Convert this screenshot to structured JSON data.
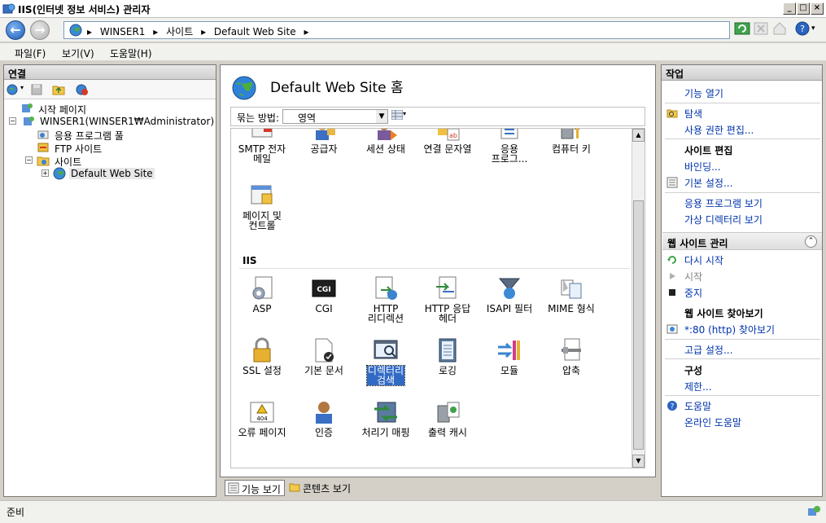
{
  "window": {
    "title": "IIS(인터넷 정보 서비스) 관리자",
    "controls": [
      "_",
      "□",
      "×"
    ]
  },
  "address": {
    "crumbs": [
      "▸",
      "WINSER1",
      "▸",
      "사이트",
      "▸",
      "Default Web Site",
      "▸"
    ]
  },
  "menu": {
    "file": "파일(F)",
    "view": "보기(V)",
    "help": "도움말(H)"
  },
  "connections": {
    "header": "연결",
    "tree": {
      "start_page": "시작 페이지",
      "server": "WINSER1(WINSER1₩Administrator)",
      "app_pools": "응용 프로그램 풀",
      "ftp_sites": "FTP 사이트",
      "sites": "사이트",
      "default_site": "Default Web Site"
    }
  },
  "features": {
    "title": "Default Web Site 홈",
    "group_by_label": "묶는 방법:",
    "group_by_value": "영역",
    "section_iis": "IIS",
    "top_row": [
      "SMTP 전자\n메일",
      "공급자",
      "세션 상태",
      "연결 문자열",
      "응용\n프로그...",
      "컴퓨터 키"
    ],
    "row_pages": [
      "페이지 및\n컨트롤"
    ],
    "iis_row1": [
      "ASP",
      "CGI",
      "HTTP\n리디렉션",
      "HTTP 응답\n헤더",
      "ISAPI 필터",
      "MIME 형식"
    ],
    "iis_row2": [
      "SSL 설정",
      "기본 문서",
      "디렉터리\n검색",
      "로깅",
      "모듈",
      "압축"
    ],
    "iis_row3": [
      "오류 페이지",
      "인증",
      "처리기 매핑",
      "출력 캐시"
    ],
    "cgi_badge": "CGI",
    "err_badge": "404"
  },
  "view_tabs": {
    "features_view": "기능 보기",
    "content_view": "콘텐츠 보기"
  },
  "actions": {
    "header": "작업",
    "open_feature": "기능 열기",
    "explore": "탐색",
    "edit_permissions": "사용 권한 편집...",
    "edit_site": "사이트 편집",
    "bindings": "바인딩...",
    "basic_settings": "기본 설정...",
    "view_apps": "응용 프로그램 보기",
    "view_vdirs": "가상 디렉터리 보기",
    "manage_site": "웹 사이트 관리",
    "restart": "다시 시작",
    "start": "시작",
    "stop": "중지",
    "browse_site": "웹 사이트 찾아보기",
    "browse_80": "*:80 (http) 찾아보기",
    "advanced_settings": "고급 설정...",
    "configure": "구성",
    "limits": "제한...",
    "help": "도움말",
    "online_help": "온라인 도움말"
  },
  "status": {
    "text": "준비"
  }
}
